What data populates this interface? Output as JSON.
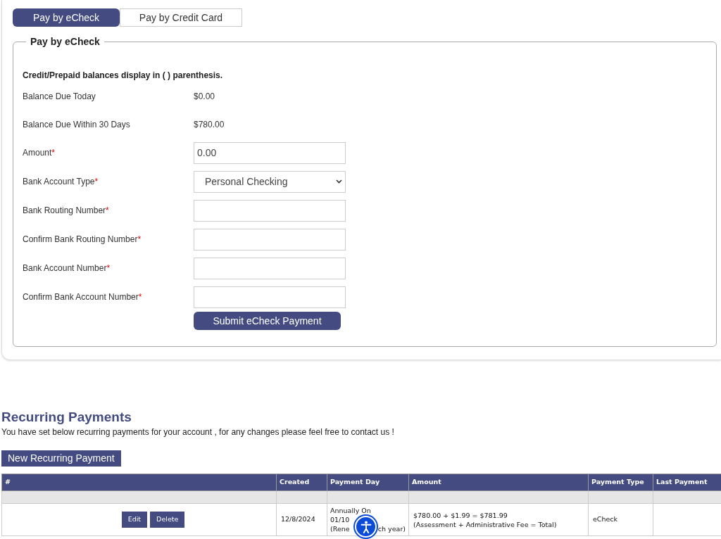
{
  "tabs": [
    {
      "label": "Pay by eCheck",
      "selected": true
    },
    {
      "label": "Pay by Credit Card",
      "selected": false
    }
  ],
  "form": {
    "legend": "Pay by eCheck",
    "note": "Credit/Prepaid balances display in ( ) parenthesis.",
    "balances": [
      {
        "label": "Balance Due Today",
        "value": "$0.00"
      },
      {
        "label": "Balance Due Within 30 Days",
        "value": "$780.00"
      }
    ],
    "fields": [
      {
        "kind": "input",
        "label": "Amount",
        "required_mark": "*",
        "value": "0.00"
      },
      {
        "kind": "select",
        "label": "Bank Account Type",
        "required_mark": "*",
        "value": "Personal Checking"
      },
      {
        "kind": "input",
        "label": "Bank Routing Number",
        "required_mark": "*"
      },
      {
        "kind": "input",
        "label": "Confirm Bank Routing Number",
        "required_mark": "*"
      },
      {
        "kind": "input",
        "label": "Bank Account Number",
        "required_mark": "*"
      },
      {
        "kind": "input",
        "label": "Confirm Bank Account Number",
        "required_mark": "*"
      }
    ],
    "submit": "Submit eCheck Payment"
  },
  "recurring": {
    "title": "Recurring Payments",
    "text": "You have set below recurring payments for your account , for any changes please feel free to contact us !",
    "new_button": "New Recurring Payment",
    "columns": [
      "#",
      "Created",
      "Payment Day",
      "Amount",
      "Payment Type",
      "Last Payment"
    ],
    "rows": [
      {
        "actions": [
          "Edit",
          "Delete"
        ],
        "created": "12/8/2024",
        "payment_day": [
          "Annually On",
          "01/10",
          "(Rene",
          "ch year)"
        ],
        "amount": [
          "$780.00 + $1.99 = $781.99",
          "(Assessment + Administrative Fee = Total)"
        ],
        "payment_type": "eCheck"
      }
    ]
  }
}
